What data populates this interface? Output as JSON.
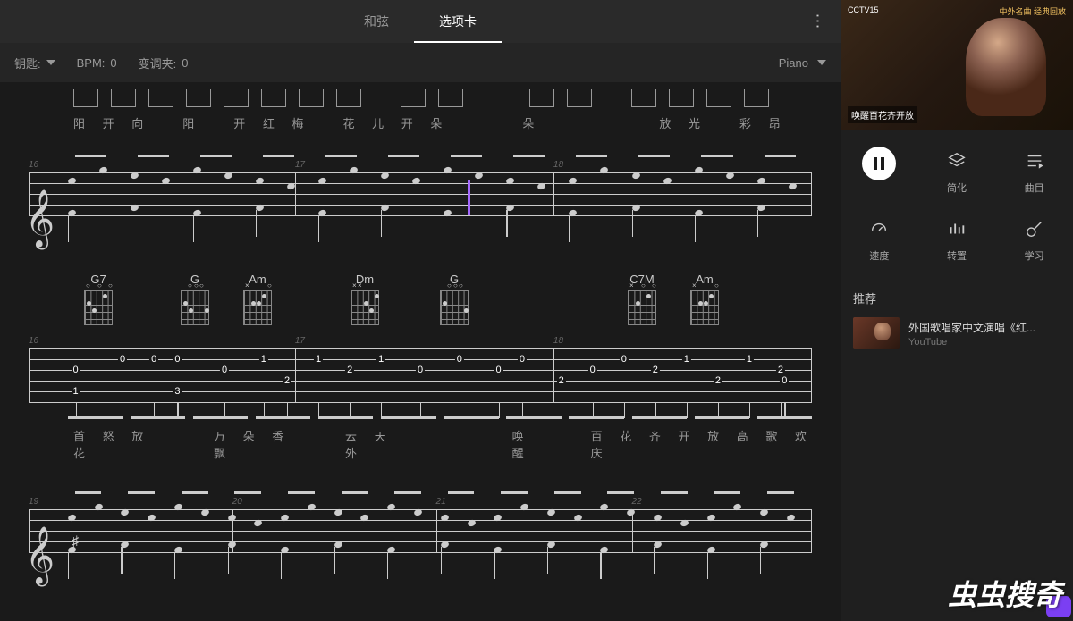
{
  "tabs": {
    "chords": "和弦",
    "tab": "选项卡"
  },
  "toolbar": {
    "key_label": "钥匙:",
    "bpm_label": "BPM:",
    "bpm_value": "0",
    "capo_label": "变调夹:",
    "capo_value": "0",
    "instrument": "Piano"
  },
  "lyrics1": {
    "a": "阳 开 向",
    "b": "阳",
    "c": "开 红 梅",
    "d": "花 儿 开 朵",
    "e": "朵",
    "f": "放 光",
    "g": "彩 昂"
  },
  "lyrics2": {
    "a": "首 怒 放 花",
    "b": "万 朵 香 飘",
    "c": "云 天 外",
    "d": "唤   醒",
    "e": "百 花 齐 开 放 高 歌 欢 庆"
  },
  "chords": {
    "c1": "G7",
    "c2": "G",
    "c3": "Am",
    "c4": "Dm",
    "c5": "G",
    "c6": "C7M",
    "c7": "Am"
  },
  "measures": {
    "m16": "16",
    "m17": "17",
    "m18": "18",
    "m19": "19",
    "m20": "20",
    "m21": "21",
    "m22": "22"
  },
  "tab_nums": {
    "row": [
      {
        "p": 0.06,
        "s": 5,
        "n": "1"
      },
      {
        "p": 0.06,
        "s": 3,
        "n": "0"
      },
      {
        "p": 0.12,
        "s": 2,
        "n": "0"
      },
      {
        "p": 0.16,
        "s": 2,
        "n": "0"
      },
      {
        "p": 0.19,
        "s": 5,
        "n": "3"
      },
      {
        "p": 0.19,
        "s": 2,
        "n": "0"
      },
      {
        "p": 0.25,
        "s": 3,
        "n": "0"
      },
      {
        "p": 0.3,
        "s": 2,
        "n": "1"
      },
      {
        "p": 0.33,
        "s": 4,
        "n": "2"
      },
      {
        "p": 0.37,
        "s": 2,
        "n": "1"
      },
      {
        "p": 0.41,
        "s": 3,
        "n": "2"
      },
      {
        "p": 0.45,
        "s": 2,
        "n": "1"
      },
      {
        "p": 0.5,
        "s": 3,
        "n": "0"
      },
      {
        "p": 0.55,
        "s": 2,
        "n": "0"
      },
      {
        "p": 0.6,
        "s": 3,
        "n": "0"
      },
      {
        "p": 0.63,
        "s": 2,
        "n": "0"
      },
      {
        "p": 0.68,
        "s": 4,
        "n": "2"
      },
      {
        "p": 0.72,
        "s": 3,
        "n": "0"
      },
      {
        "p": 0.76,
        "s": 2,
        "n": "0"
      },
      {
        "p": 0.8,
        "s": 3,
        "n": "2"
      },
      {
        "p": 0.84,
        "s": 2,
        "n": "1"
      },
      {
        "p": 0.88,
        "s": 4,
        "n": "2"
      },
      {
        "p": 0.92,
        "s": 2,
        "n": "1"
      },
      {
        "p": 0.96,
        "s": 3,
        "n": "2"
      },
      {
        "p": 0.965,
        "s": 4,
        "n": "0"
      }
    ]
  },
  "controls": {
    "pause": "",
    "simplify": "简化",
    "tracks": "曲目",
    "speed": "速度",
    "transpose": "转置",
    "learn": "学习"
  },
  "video": {
    "channel": "CCTV15",
    "tag": "中外名曲  经典回放",
    "caption": "唤醒百花齐开放"
  },
  "rec": {
    "title": "推荐",
    "item_name": "外国歌唱家中文演唱《红...",
    "item_src": "YouTube"
  },
  "watermark": "虫虫搜奇",
  "icons": {
    "layers": "layers-icon",
    "tracks": "tracks-icon",
    "speed": "gauge-icon",
    "eq": "equalizer-icon",
    "guitar": "guitar-icon"
  }
}
